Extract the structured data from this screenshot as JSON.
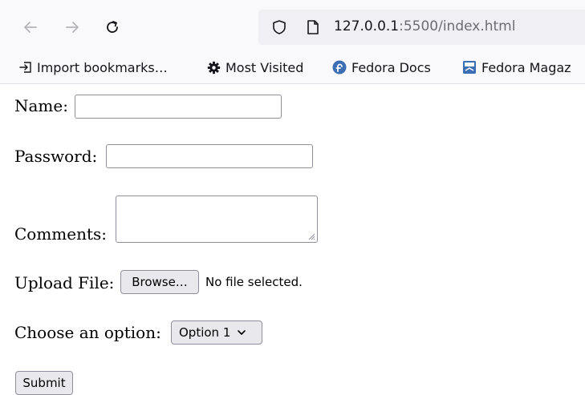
{
  "browser": {
    "url_host": "127.0.0.1",
    "url_rest": ":5500/index.html",
    "nav": {
      "back_icon": "back-arrow-icon",
      "forward_icon": "forward-arrow-icon",
      "reload_icon": "reload-icon"
    },
    "bookmarks": [
      {
        "label": "Import bookmarks…",
        "icon": "import-icon"
      },
      {
        "label": "Most Visited",
        "icon": "gear-icon"
      },
      {
        "label": "Fedora Docs",
        "icon": "fedora-icon"
      },
      {
        "label": "Fedora Magaz",
        "icon": "fedora-magazine-icon"
      }
    ]
  },
  "form": {
    "name_label": "Name:",
    "password_label": "Password:",
    "comments_label": "Comments:",
    "upload_label": "Upload File:",
    "browse_button": "Browse…",
    "no_file_text": "No file selected.",
    "choose_label": "Choose an option:",
    "select_value": "Option 1",
    "submit_button": "Submit"
  },
  "colors": {
    "toolbar_bg": "#f9f9fb",
    "urlbar_bg": "#f0f0f4",
    "button_bg": "#e9e9ed",
    "fedora_blue": "#3c6eb4"
  }
}
